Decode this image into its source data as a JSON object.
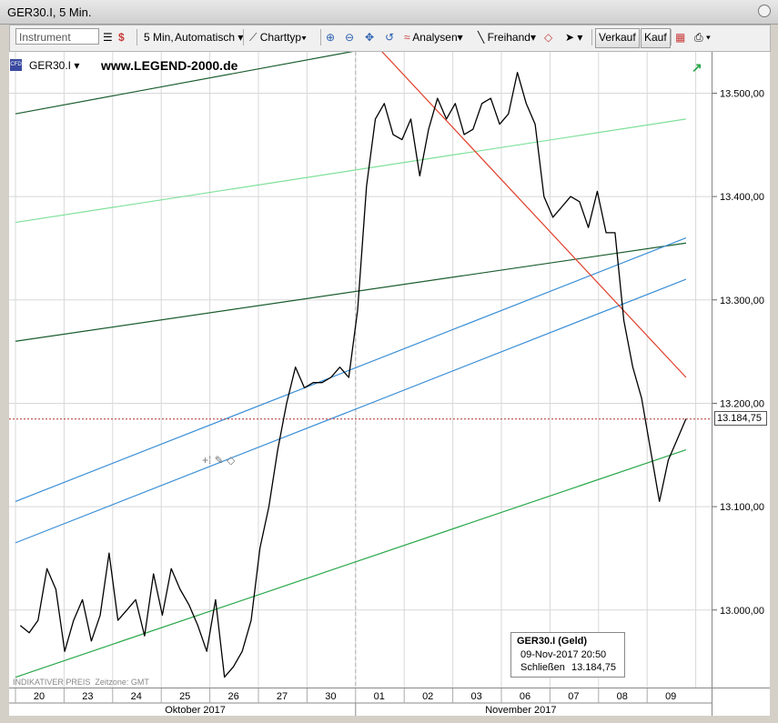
{
  "window": {
    "title": "GER30.I, 5 Min."
  },
  "toolbar": {
    "instrument_placeholder": "Instrument",
    "interval_label": "5 Min,",
    "scale_label": "Automatisch",
    "charttype_label": "Charttyp",
    "analysen_label": "Analysen",
    "freihand_label": "Freihand",
    "verkauf_label": "Verkauf",
    "kauf_label": "Kauf"
  },
  "legend": {
    "instrument": "GER30.I",
    "website": "www.LEGEND-2000.de",
    "cfd_badge": "CFD"
  },
  "footer": {
    "indicative": "INDIKATIVER PREIS",
    "timezone": "Zeitzone: GMT"
  },
  "price_tag": "13.184,75",
  "info_box": {
    "title": "GER30.I (Geld)",
    "datetime": "09-Nov-2017 20:50",
    "close_label": "Schließen",
    "close_value": "13.184,75"
  },
  "chart_data": {
    "type": "line",
    "x_day_labels": [
      "20",
      "23",
      "24",
      "25",
      "26",
      "27",
      "30",
      "01",
      "02",
      "03",
      "06",
      "07",
      "08",
      "09"
    ],
    "x_month_labels": [
      "Oktober 2017",
      "November 2017"
    ],
    "y_tick_labels": [
      "13.000,00",
      "13.100,00",
      "13.200,00",
      "13.300,00",
      "13.400,00",
      "13.500,00"
    ],
    "y_ticks": [
      13000,
      13100,
      13200,
      13300,
      13400,
      13500
    ],
    "ylim": [
      12925,
      13540
    ],
    "current_price": 13184.75,
    "series": [
      {
        "values": [
          12985,
          12978,
          12990,
          13040,
          13020,
          12960,
          12990,
          13010,
          12970,
          12995,
          13055,
          12990,
          13000,
          13010,
          12975,
          13035,
          12995,
          13040,
          13020,
          13005,
          12985,
          12960,
          13010,
          12935,
          12945,
          12960,
          12990,
          13060,
          13100,
          13155,
          13200,
          13235,
          13215,
          13220,
          13220,
          13225,
          13235,
          13225,
          13290,
          13410,
          13475,
          13490,
          13460,
          13455,
          13475,
          13420,
          13465,
          13495,
          13475,
          13490,
          13460,
          13465,
          13490,
          13495,
          13470,
          13480,
          13520,
          13490,
          13470,
          13400,
          13380,
          13390,
          13400,
          13395,
          13370,
          13405,
          13365,
          13365,
          13280,
          13235,
          13205,
          13155,
          13105,
          13145,
          13165,
          13185
        ]
      }
    ],
    "trendlines": [
      {
        "color": "#1a5d2e",
        "from": [
          0,
          13480
        ],
        "to": [
          8.62,
          13555
        ]
      },
      {
        "color": "#7fe09a",
        "from": [
          0,
          13375
        ],
        "to": [
          13.8,
          13475
        ]
      },
      {
        "color": "#1a5d2e",
        "from": [
          0,
          13260
        ],
        "to": [
          13.8,
          13355
        ]
      },
      {
        "color": "#3b8fd6",
        "from": [
          0,
          13105
        ],
        "to": [
          13.8,
          13360
        ]
      },
      {
        "color": "#3b8fd6",
        "from": [
          0,
          13065
        ],
        "to": [
          13.8,
          13320
        ]
      },
      {
        "color": "#2aa84a",
        "from": [
          0,
          12935
        ],
        "to": [
          13.8,
          13155
        ]
      },
      {
        "color": "#e0402a",
        "from": [
          7.25,
          13555
        ],
        "to": [
          13.8,
          13225
        ]
      }
    ]
  }
}
